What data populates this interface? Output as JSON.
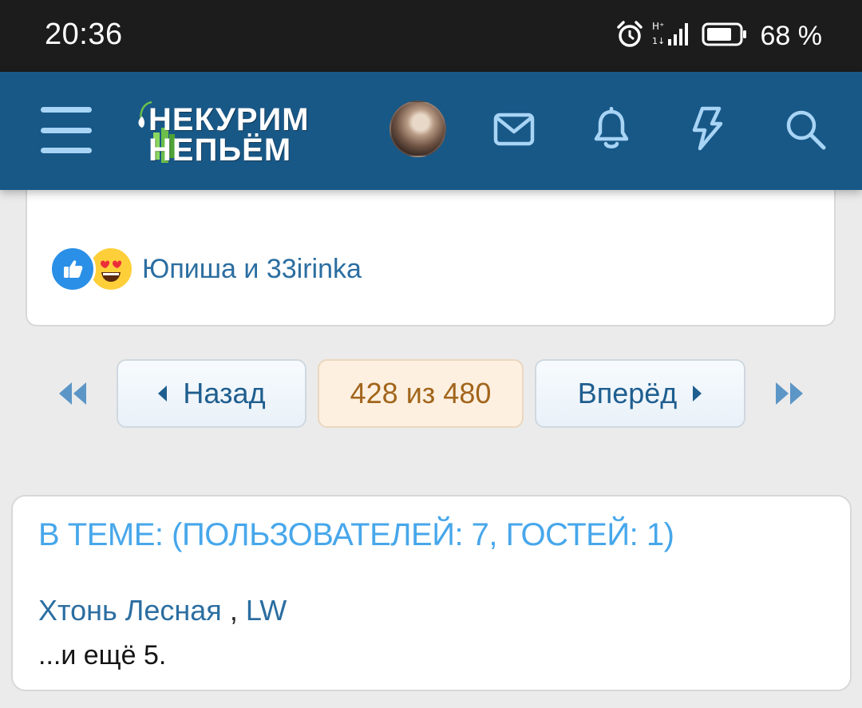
{
  "status_bar": {
    "time": "20:36",
    "battery_percent": "68 %",
    "icons": [
      "alarm-icon",
      "signal-icon",
      "battery-icon"
    ]
  },
  "header": {
    "logo": {
      "line1": "НЕКУРИМ",
      "line2": "НЕПЬЁМ"
    },
    "icons": [
      "menu-icon",
      "avatar",
      "mail-icon",
      "bell-icon",
      "lightning-icon",
      "search-icon"
    ],
    "background": "#185887",
    "icon_color": "#a8d4f5"
  },
  "post": {
    "reaction_icons": [
      "thumbs-up-icon",
      "heart-eyes-icon"
    ],
    "reactors": "Юпиша и 33irinka"
  },
  "pagination": {
    "prev_label": "Назад",
    "current": "428 из 480",
    "next_label": "Вперёд",
    "icons": [
      "first-page-icon",
      "last-page-icon"
    ]
  },
  "in_topic": {
    "title": "В ТЕМЕ: (ПОЛЬЗОВАТЕЛЕЙ: 7, ГОСТЕЙ: 1)",
    "users": [
      "Хтонь Лесная",
      "LW"
    ],
    "separator": ",",
    "more": "...и ещё 5."
  },
  "colors": {
    "page_bg": "#ebebeb",
    "link": "#2b6ea1",
    "title": "#47a7eb",
    "current_page": "#a2651c"
  }
}
